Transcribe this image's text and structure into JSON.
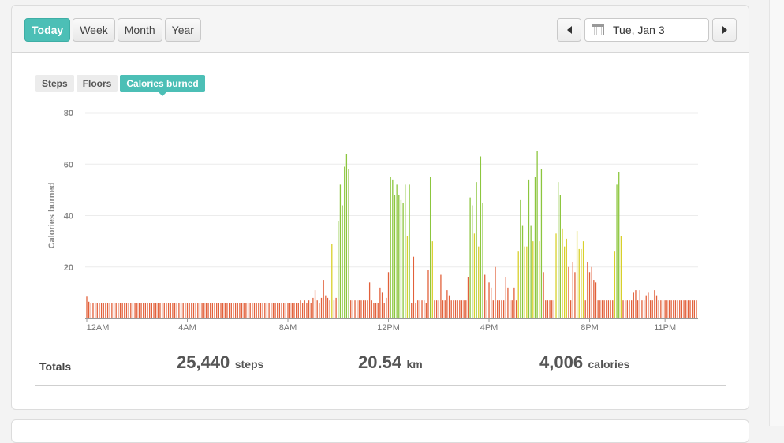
{
  "range_tabs": [
    "Today",
    "Week",
    "Month",
    "Year"
  ],
  "date": {
    "label": "Tue, Jan 3"
  },
  "metric_tabs": [
    "Steps",
    "Floors",
    "Calories burned"
  ],
  "totals": {
    "label": "Totals",
    "items": [
      {
        "value": "25,440",
        "unit": "steps"
      },
      {
        "value": "20.54",
        "unit": "km"
      },
      {
        "value": "4,006",
        "unit": "calories"
      }
    ]
  },
  "colors": {
    "accent": "#4cbfb6",
    "low": "#e2603a",
    "mid": "#d8d02a",
    "high": "#8cc63e"
  },
  "chart_data": {
    "type": "bar",
    "ylabel": "Calories burned",
    "ylim": [
      0,
      80
    ],
    "yticks": [
      20,
      40,
      60,
      80
    ],
    "grid": true,
    "x_unit": "minute of day, 5-minute buckets",
    "xticks": [
      {
        "label": "12AM",
        "x": 0
      },
      {
        "label": "4AM",
        "x": 240
      },
      {
        "label": "8AM",
        "x": 480
      },
      {
        "label": "12PM",
        "x": 720
      },
      {
        "label": "4PM",
        "x": 960
      },
      {
        "label": "8PM",
        "x": 1200
      },
      {
        "label": "11PM",
        "x": 1380
      }
    ],
    "base_values": [
      8.5,
      6.5,
      6,
      6,
      6,
      6,
      6,
      6,
      6,
      6,
      6,
      6,
      6,
      6,
      6,
      6,
      6,
      6,
      6,
      6,
      6,
      6,
      6,
      6,
      6,
      6,
      6,
      6,
      6,
      6,
      6,
      6,
      6,
      6,
      6,
      6,
      6,
      6,
      6,
      6,
      6,
      6,
      6,
      6,
      6,
      6,
      6,
      6,
      6,
      6,
      6,
      6,
      6,
      6,
      6,
      6,
      6,
      6,
      6,
      6,
      6,
      6,
      6,
      6,
      6,
      6,
      6,
      6,
      6,
      6,
      6,
      6,
      6,
      6,
      6,
      6,
      6,
      6,
      6,
      6,
      6,
      6,
      6,
      6,
      6,
      6,
      6,
      6,
      6,
      6,
      6,
      6,
      6,
      6,
      6,
      6,
      6,
      6,
      6,
      6,
      6,
      6,
      7,
      6,
      7,
      6,
      7,
      6,
      8,
      11,
      7,
      6,
      8,
      7,
      9,
      8,
      7,
      6,
      7,
      8,
      6,
      7,
      7,
      7,
      7,
      7,
      7,
      7,
      7,
      7,
      7,
      7,
      7,
      7,
      7,
      7,
      7,
      6,
      6,
      6,
      6,
      6,
      6,
      6,
      6,
      6,
      6,
      6,
      6,
      6,
      6,
      6,
      7,
      7,
      6,
      6,
      7,
      6,
      7,
      7,
      7,
      7,
      6,
      7,
      8,
      7,
      7,
      7,
      7,
      7,
      7,
      7,
      7,
      7,
      7,
      7,
      7,
      7,
      7,
      7,
      7,
      7,
      7,
      7,
      7,
      7,
      7,
      7,
      7,
      7,
      7,
      7,
      7,
      7,
      7,
      7,
      7,
      7,
      7,
      7,
      7,
      7,
      7,
      7,
      7,
      7,
      7,
      7,
      7,
      7,
      7,
      7,
      7,
      7,
      7,
      7,
      7,
      7,
      7,
      7,
      7,
      7,
      7,
      7,
      7,
      7,
      7,
      7,
      7,
      7,
      7,
      7,
      7,
      7,
      7,
      7,
      7,
      7,
      7,
      7,
      7,
      7,
      7,
      7,
      7,
      7,
      7,
      7,
      7,
      7,
      7,
      7,
      7,
      7,
      7,
      7,
      7,
      7,
      7,
      7,
      7,
      7,
      7,
      7,
      7,
      7,
      7,
      7,
      7,
      7,
      7,
      7,
      7,
      7,
      7,
      7,
      7,
      7,
      7,
      7,
      7,
      7,
      7,
      7,
      7,
      7,
      7,
      7,
      7,
      7,
      7,
      7
    ],
    "spikes": [
      [
        113,
        15
      ],
      [
        117,
        29
      ],
      [
        120,
        38
      ],
      [
        121,
        52
      ],
      [
        122,
        44
      ],
      [
        123,
        59
      ],
      [
        124,
        64
      ],
      [
        125,
        58
      ],
      [
        128,
        7
      ],
      [
        133,
        7
      ],
      [
        135,
        14
      ],
      [
        140,
        12
      ],
      [
        141,
        10
      ],
      [
        143,
        8
      ],
      [
        144,
        18
      ],
      [
        145,
        55
      ],
      [
        146,
        54
      ],
      [
        147,
        48
      ],
      [
        148,
        52
      ],
      [
        149,
        48
      ],
      [
        150,
        46
      ],
      [
        151,
        45
      ],
      [
        152,
        52
      ],
      [
        153,
        32
      ],
      [
        154,
        52
      ],
      [
        156,
        24
      ],
      [
        163,
        19
      ],
      [
        164,
        55
      ],
      [
        165,
        30
      ],
      [
        169,
        17
      ],
      [
        172,
        11
      ],
      [
        173,
        9
      ],
      [
        182,
        16
      ],
      [
        183,
        47
      ],
      [
        184,
        44
      ],
      [
        185,
        33
      ],
      [
        186,
        53
      ],
      [
        187,
        28
      ],
      [
        188,
        63
      ],
      [
        189,
        45
      ],
      [
        190,
        17
      ],
      [
        192,
        14
      ],
      [
        193,
        12
      ],
      [
        195,
        20
      ],
      [
        200,
        16
      ],
      [
        201,
        12
      ],
      [
        204,
        12
      ],
      [
        206,
        26
      ],
      [
        207,
        46
      ],
      [
        208,
        36
      ],
      [
        209,
        28
      ],
      [
        210,
        28
      ],
      [
        211,
        54
      ],
      [
        212,
        36
      ],
      [
        213,
        30
      ],
      [
        214,
        55
      ],
      [
        215,
        65
      ],
      [
        216,
        30
      ],
      [
        217,
        58
      ],
      [
        218,
        18
      ],
      [
        224,
        33
      ],
      [
        225,
        53
      ],
      [
        226,
        48
      ],
      [
        227,
        35
      ],
      [
        228,
        28
      ],
      [
        229,
        31
      ],
      [
        230,
        20
      ],
      [
        232,
        22
      ],
      [
        233,
        18
      ],
      [
        234,
        34
      ],
      [
        235,
        27
      ],
      [
        236,
        27
      ],
      [
        237,
        30
      ],
      [
        239,
        22
      ],
      [
        240,
        18
      ],
      [
        241,
        20
      ],
      [
        242,
        15
      ],
      [
        243,
        14
      ],
      [
        252,
        26
      ],
      [
        253,
        52
      ],
      [
        254,
        57
      ],
      [
        255,
        32
      ],
      [
        261,
        10
      ],
      [
        262,
        11
      ],
      [
        264,
        11
      ],
      [
        267,
        9
      ],
      [
        268,
        10
      ],
      [
        271,
        11
      ],
      [
        272,
        9
      ]
    ],
    "low_color_below": 25,
    "high_color_from": 36
  }
}
